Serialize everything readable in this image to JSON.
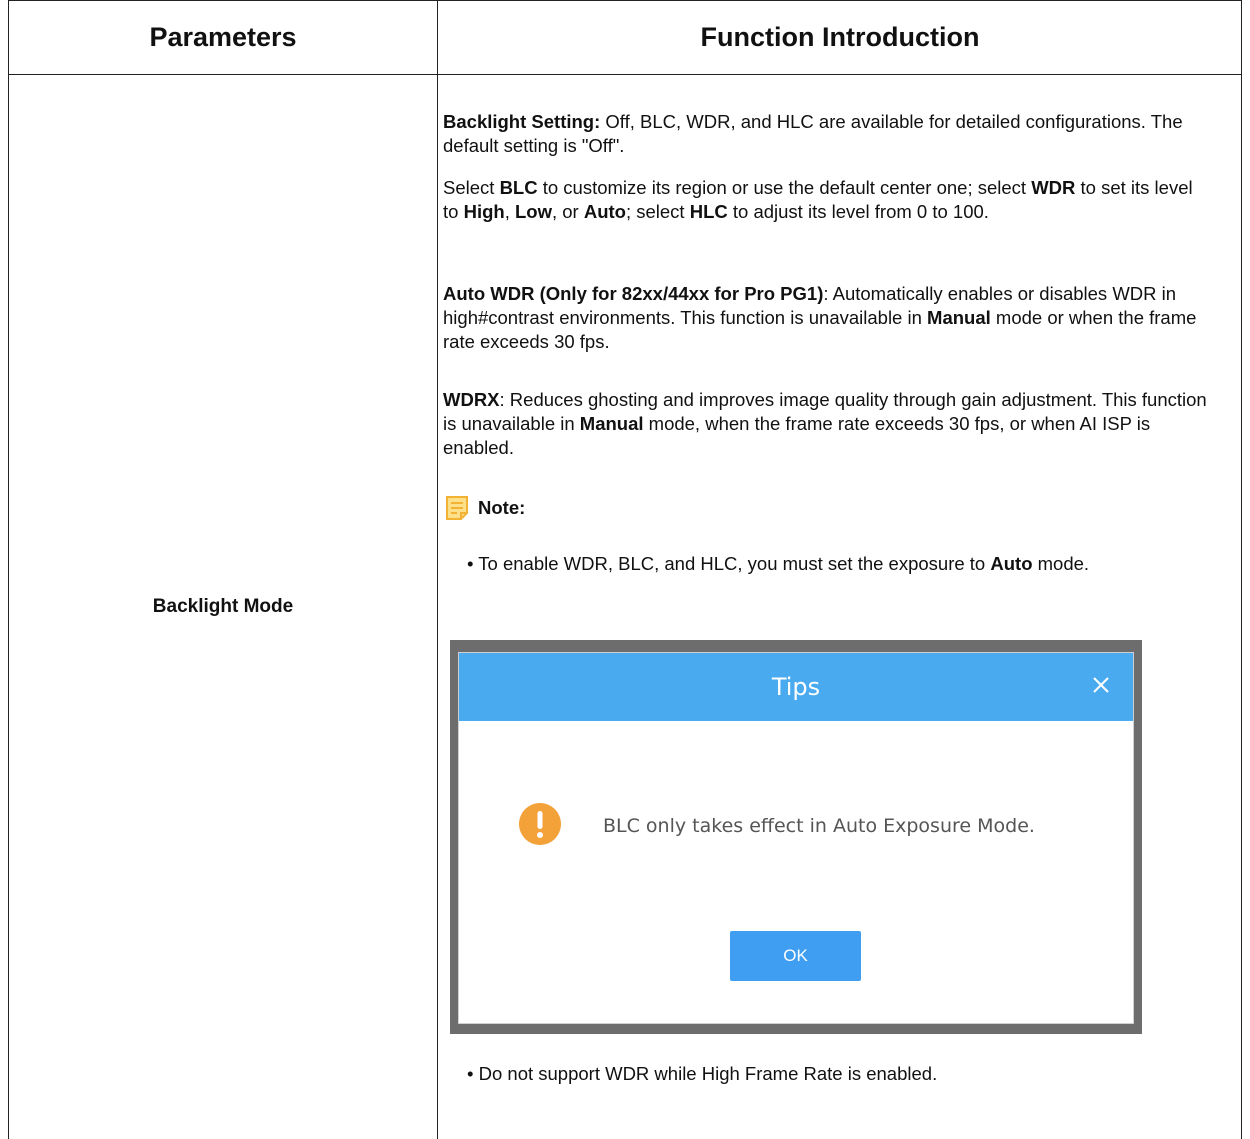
{
  "table": {
    "headers": [
      "Parameters",
      "Function Introduction"
    ],
    "param_name": "Backlight Mode"
  },
  "content": {
    "p1": [
      {
        "t": "Backlight Setting:",
        "b": true
      },
      {
        "t": " Off, BLC, WDR, and HLC are available for detailed configurations. The default setting is \"Off\".",
        "b": false
      }
    ],
    "p2": [
      {
        "t": "Select ",
        "b": false
      },
      {
        "t": "BLC",
        "b": true
      },
      {
        "t": " to customize its region or use the default center one; select ",
        "b": false
      },
      {
        "t": "WDR",
        "b": true
      },
      {
        "t": " to set its level to ",
        "b": false
      },
      {
        "t": "High",
        "b": true
      },
      {
        "t": ", ",
        "b": false
      },
      {
        "t": "Low",
        "b": true
      },
      {
        "t": ", or ",
        "b": false
      },
      {
        "t": "Auto",
        "b": true
      },
      {
        "t": "; select ",
        "b": false
      },
      {
        "t": "HLC",
        "b": true
      },
      {
        "t": " to adjust its level from 0 to 100.",
        "b": false
      }
    ],
    "p3": [
      {
        "t": "Auto WDR (Only for 82xx/44xx for Pro PG1)",
        "b": true
      },
      {
        "t": ": Automatically enables or disables WDR in high#contrast environments. This function is unavailable in ",
        "b": false
      },
      {
        "t": "Manual",
        "b": true
      },
      {
        "t": " mode or when the frame rate exceeds 30 fps.",
        "b": false
      }
    ],
    "p4": [
      {
        "t": "WDRX",
        "b": true
      },
      {
        "t": ": Reduces ghosting and improves image quality through gain adjustment. This function is unavailable in ",
        "b": false
      },
      {
        "t": "Manual",
        "b": true
      },
      {
        "t": " mode, when the frame rate exceeds 30 fps, or when AI ISP is enabled.",
        "b": false
      }
    ],
    "note_label": "Note:",
    "bullet1": [
      {
        "t": "• To enable WDR, BLC, and HLC, you must set the exposure to ",
        "b": false
      },
      {
        "t": "Auto",
        "b": true
      },
      {
        "t": " mode.",
        "b": false
      }
    ],
    "bullet2": [
      {
        "t": "• Do not support WDR while High Frame Rate is enabled.",
        "b": false
      }
    ]
  },
  "dialog": {
    "title": "Tips",
    "message": "BLC only takes effect in Auto Exposure Mode.",
    "ok_label": "OK",
    "header_color": "#4aaaf0",
    "button_color": "#3f9ef2",
    "warning_color": "#f3a23a"
  },
  "icons": [
    "note-icon",
    "close-icon",
    "warning-icon"
  ]
}
